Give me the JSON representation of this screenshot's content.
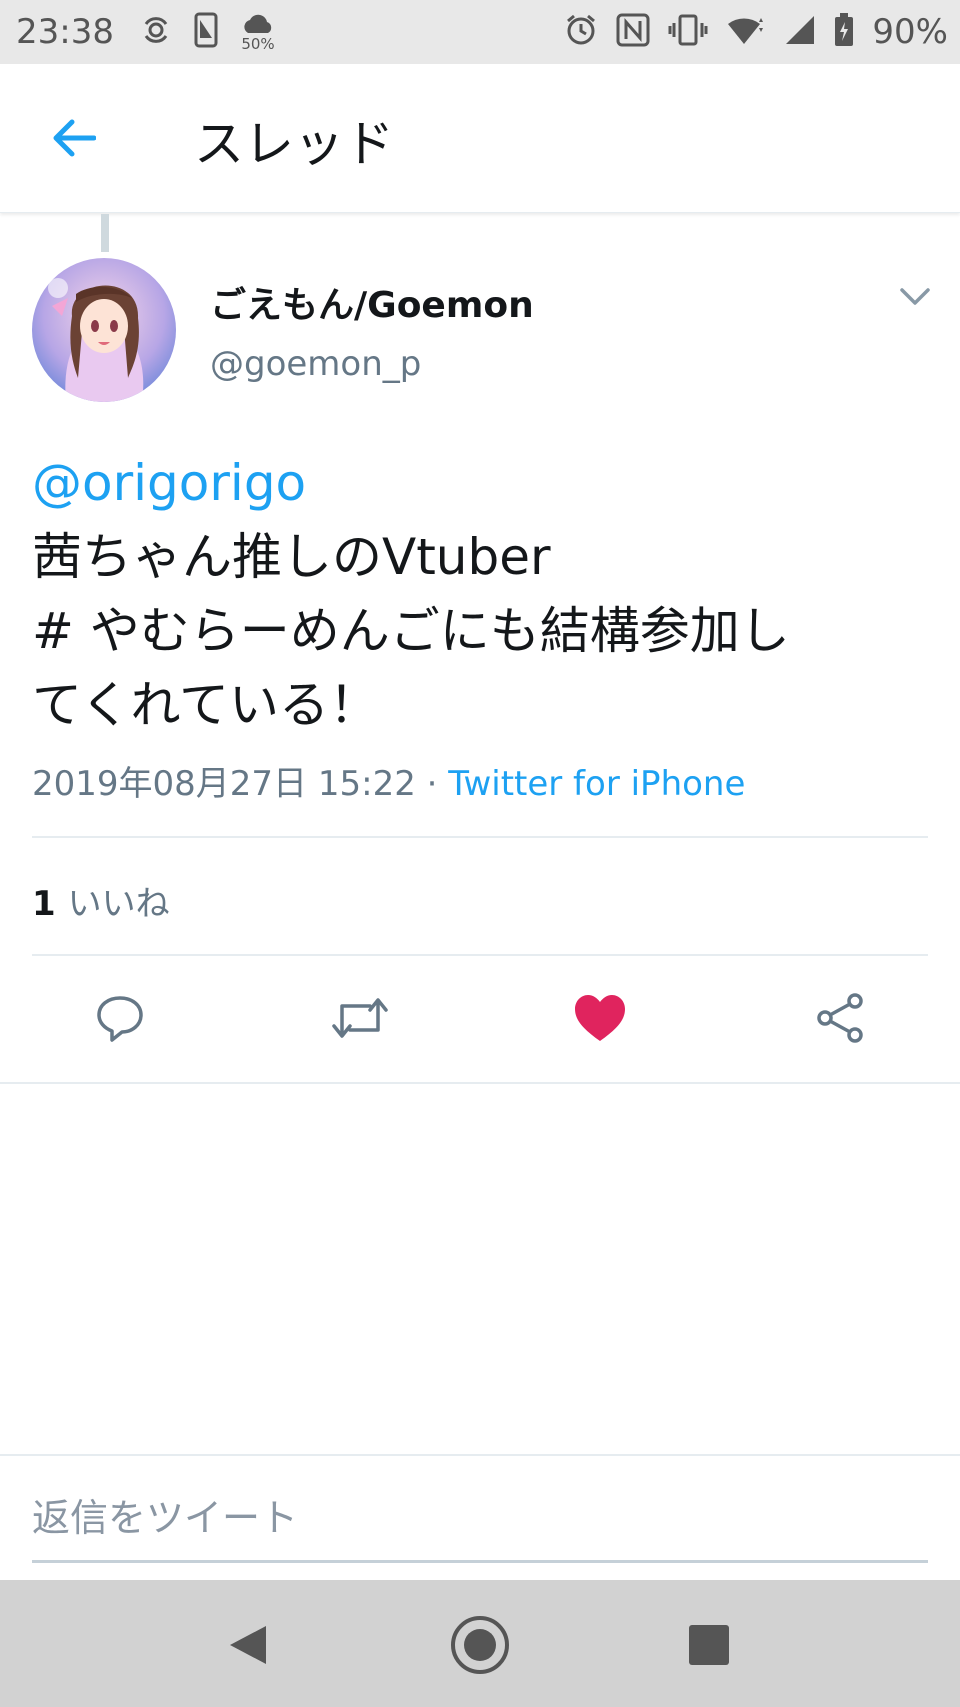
{
  "status_bar": {
    "time": "23:38",
    "weather_label": "50%",
    "battery_text": "90%"
  },
  "app_bar": {
    "title": "スレッド"
  },
  "tweet": {
    "display_name": "ごえもん/Goemon",
    "handle": "@goemon_p",
    "mention": "@origorigo",
    "text_lines": [
      "茜ちゃん推しのVtuber",
      "# やむらーめんごにも結構参加し",
      "てくれている！"
    ],
    "timestamp": "2019年08月27日 15:22",
    "separator": "·",
    "source": "Twitter for iPhone",
    "like_count": "1",
    "like_label": "いいね"
  },
  "reply": {
    "placeholder": "返信をツイート"
  },
  "colors": {
    "accent": "#1da1f2",
    "like_active": "#e0245e",
    "secondary_text": "#657786"
  },
  "icons": {
    "back": "arrow-left-icon",
    "reply": "speech-bubble-icon",
    "retweet": "retweet-icon",
    "like": "heart-filled-icon",
    "share": "share-icon"
  }
}
